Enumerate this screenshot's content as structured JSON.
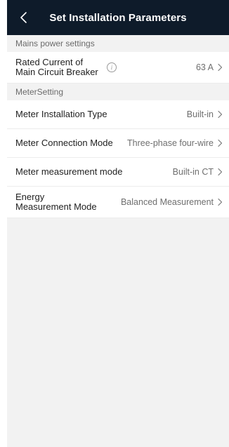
{
  "header": {
    "title": "Set Installation Parameters"
  },
  "sections": {
    "mains": {
      "title": "Mains power settings",
      "rated_current": {
        "label": "Rated Current of Main Circuit Breaker",
        "value": "63 A"
      }
    },
    "meter": {
      "title": "MeterSetting",
      "installation_type": {
        "label": "Meter Installation Type",
        "value": "Built-in"
      },
      "connection_mode": {
        "label": "Meter Connection Mode",
        "value": "Three-phase four-wire"
      },
      "measurement_mode": {
        "label": "Meter measurement mode",
        "value": "Built-in CT"
      },
      "energy_measurement_mode": {
        "label": "Energy Measurement Mode",
        "value": "Balanced Measurement"
      }
    }
  },
  "colors": {
    "header_bg": "#0e1b2a",
    "page_bg": "#f2f2f2"
  },
  "icons": {
    "back": "chevron-left-icon",
    "info": "info-icon",
    "row_arrow": "chevron-right-icon"
  }
}
